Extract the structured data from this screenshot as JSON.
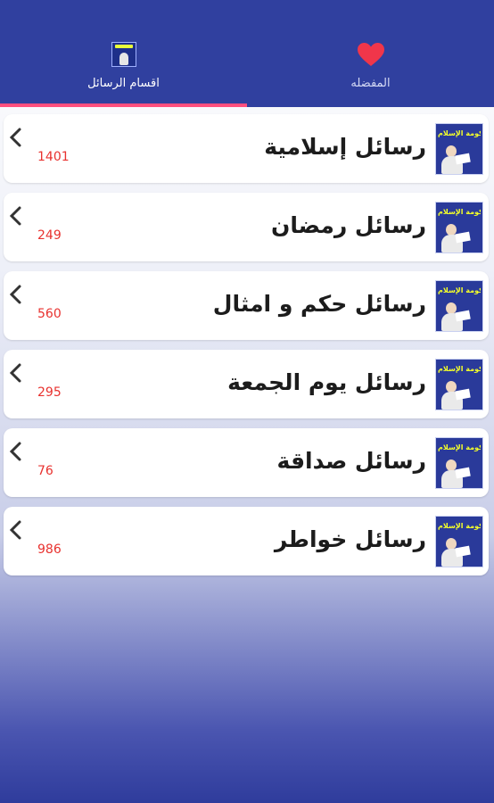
{
  "tabs": {
    "categories": {
      "label": "اقسام الرسائل",
      "icon": "category-thumbnail-icon"
    },
    "favorites": {
      "label": "المفضله",
      "icon": "heart-icon"
    }
  },
  "colors": {
    "header": "#30409f",
    "indicator": "#ff4f7e",
    "heart": "#f0364a",
    "count": "#e8322f"
  },
  "thumb_caption": "حكومة الإسلام",
  "categories": [
    {
      "title": "رسائل إسلامية",
      "count": "1401"
    },
    {
      "title": "رسائل رمضان",
      "count": "249"
    },
    {
      "title": "رسائل حكم و امثال",
      "count": "560"
    },
    {
      "title": "رسائل يوم الجمعة",
      "count": "295"
    },
    {
      "title": "رسائل صداقة",
      "count": "76"
    },
    {
      "title": "رسائل خواطر",
      "count": "986"
    }
  ]
}
